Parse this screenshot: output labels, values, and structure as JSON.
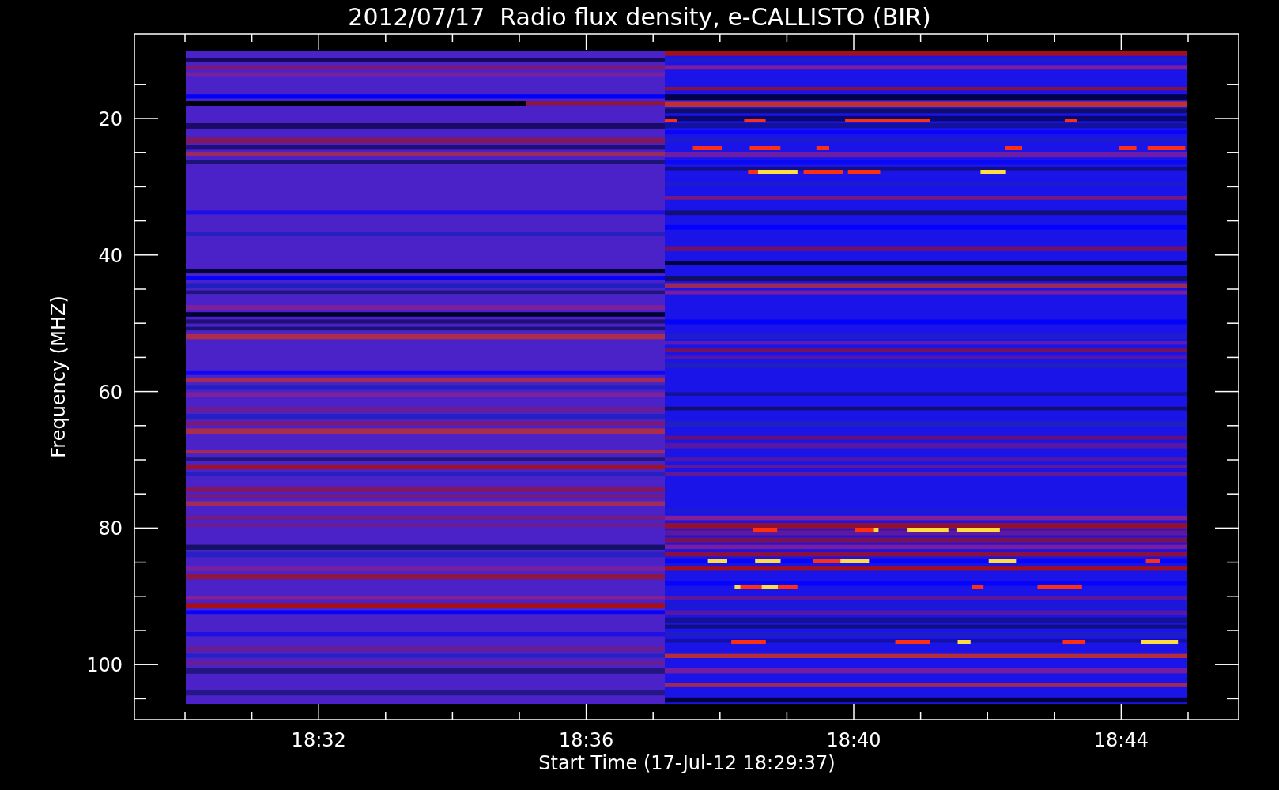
{
  "title": "2012/07/17  Radio flux density, e-CALLISTO (BIR)",
  "y_axis": {
    "label": "Frequency (MHZ)",
    "ticks": [
      "20",
      "40",
      "60",
      "80",
      "100"
    ]
  },
  "x_axis": {
    "label": "Start Time (17-Jul-12 18:29:37)",
    "ticks": [
      "18:32",
      "18:36",
      "18:40",
      "18:44"
    ]
  }
}
